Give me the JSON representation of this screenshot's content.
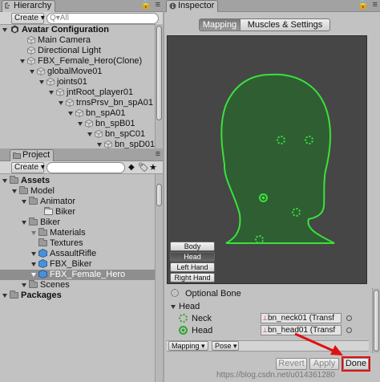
{
  "hierarchy": {
    "tab_title": "Hierarchy",
    "create_label": "Create ▾",
    "search_placeholder": "Q▾All",
    "root_label": "Avatar Configuration",
    "items": [
      {
        "label": "Main Camera"
      },
      {
        "label": "Directional Light"
      },
      {
        "label": "FBX_Female_Hero(Clone)"
      },
      {
        "label": "globalMove01"
      },
      {
        "label": "joints01"
      },
      {
        "label": "jntRoot_player01"
      },
      {
        "label": "trnsPrsv_bn_spA01"
      },
      {
        "label": "bn_spA01"
      },
      {
        "label": "bn_spB01"
      },
      {
        "label": "bn_spC01"
      },
      {
        "label": "bn_spD01"
      }
    ]
  },
  "project": {
    "tab_title": "Project",
    "create_label": "Create ▾",
    "items": [
      {
        "label": "Assets"
      },
      {
        "label": "Model"
      },
      {
        "label": "Animator"
      },
      {
        "label": "Biker"
      },
      {
        "label": "Biker"
      },
      {
        "label": "Materials"
      },
      {
        "label": "Textures"
      },
      {
        "label": "AssaultRifle"
      },
      {
        "label": "FBX_Biker"
      },
      {
        "label": "FBX_Female_Hero"
      },
      {
        "label": "Scenes"
      },
      {
        "label": "Packages"
      }
    ]
  },
  "inspector": {
    "tab_title": "Inspector",
    "tabs": [
      {
        "label": "Mapping"
      },
      {
        "label": "Muscles & Settings"
      }
    ],
    "body_parts": [
      {
        "label": "Body"
      },
      {
        "label": "Head"
      },
      {
        "label": "Left Hand"
      },
      {
        "label": "Right Hand"
      }
    ],
    "optional_bone_label": "Optional Bone",
    "group_label": "Head",
    "bones": [
      {
        "label": "Neck",
        "value": "bn_neck01 (Transf"
      },
      {
        "label": "Head",
        "value": "bn_head01 (Transf"
      }
    ],
    "footer": {
      "mapping_label": "Mapping ▾",
      "pose_label": "Pose ▾",
      "revert_label": "Revert",
      "apply_label": "Apply",
      "done_label": "Done"
    },
    "watermark": "https://blog.csdn.net/u014361280"
  },
  "colors": {
    "panel_bg": "#c2c2c2",
    "viewport_bg": "#464646",
    "silhouette_fill": "#2f5e33",
    "bone_green": "#39e23b",
    "highlight_red": "#e01010"
  }
}
